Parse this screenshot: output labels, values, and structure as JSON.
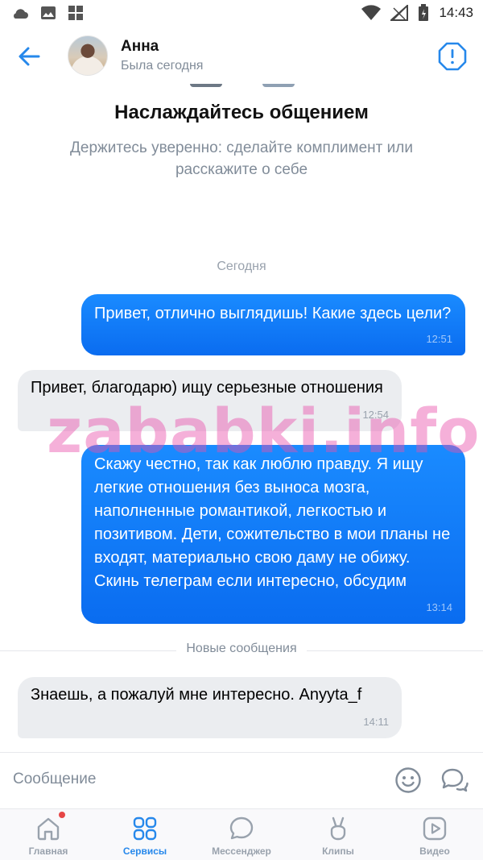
{
  "status_bar": {
    "time": "14:43"
  },
  "header": {
    "contact_name": "Анна",
    "contact_status": "Была сегодня"
  },
  "intro": {
    "title": "Наслаждайтесь общением",
    "text": "Держитесь уверенно: сделайте комплимент или расскажите о себе"
  },
  "day_separator": "Сегодня",
  "messages": [
    {
      "direction": "out",
      "text": "Привет, отлично выглядишь! Какие здесь цели?",
      "time": "12:51"
    },
    {
      "direction": "in",
      "text": "Привет, благодарю) ищу серьезные отношения",
      "time": "12:54"
    },
    {
      "direction": "out",
      "text": "Скажу честно, так как люблю правду. Я ищу легкие отношения без выноса мозга, наполненные романтикой, легкостью и позитивом. Дети, сожительство в мои планы не входят, материально свою даму не обижу. Скинь телеграм если интересно, обсудим",
      "time": "13:14"
    },
    {
      "direction": "in",
      "text": "Знаешь, а пожалуй мне интересно. Anyyta_f",
      "time": "14:11"
    }
  ],
  "new_messages_separator": "Новые сообщения",
  "watermark": "zababki.info",
  "composer": {
    "placeholder": "Сообщение"
  },
  "tabs": [
    {
      "label": "Главная",
      "icon": "home-icon",
      "active": false,
      "badge_dot": true
    },
    {
      "label": "Сервисы",
      "icon": "services-icon",
      "active": true,
      "badge_dot": false
    },
    {
      "label": "Мессенджер",
      "icon": "messenger-icon",
      "active": false,
      "badge_dot": false
    },
    {
      "label": "Клипы",
      "icon": "clips-icon",
      "active": false,
      "badge_dot": false
    },
    {
      "label": "Видео",
      "icon": "video-icon",
      "active": false,
      "badge_dot": false
    }
  ],
  "colors": {
    "accent": "#2688eb",
    "outgoing_bubble": "#0a6cf0",
    "incoming_bubble": "#ebedf0",
    "secondary_text": "#818c99",
    "badge": "#e64646"
  }
}
